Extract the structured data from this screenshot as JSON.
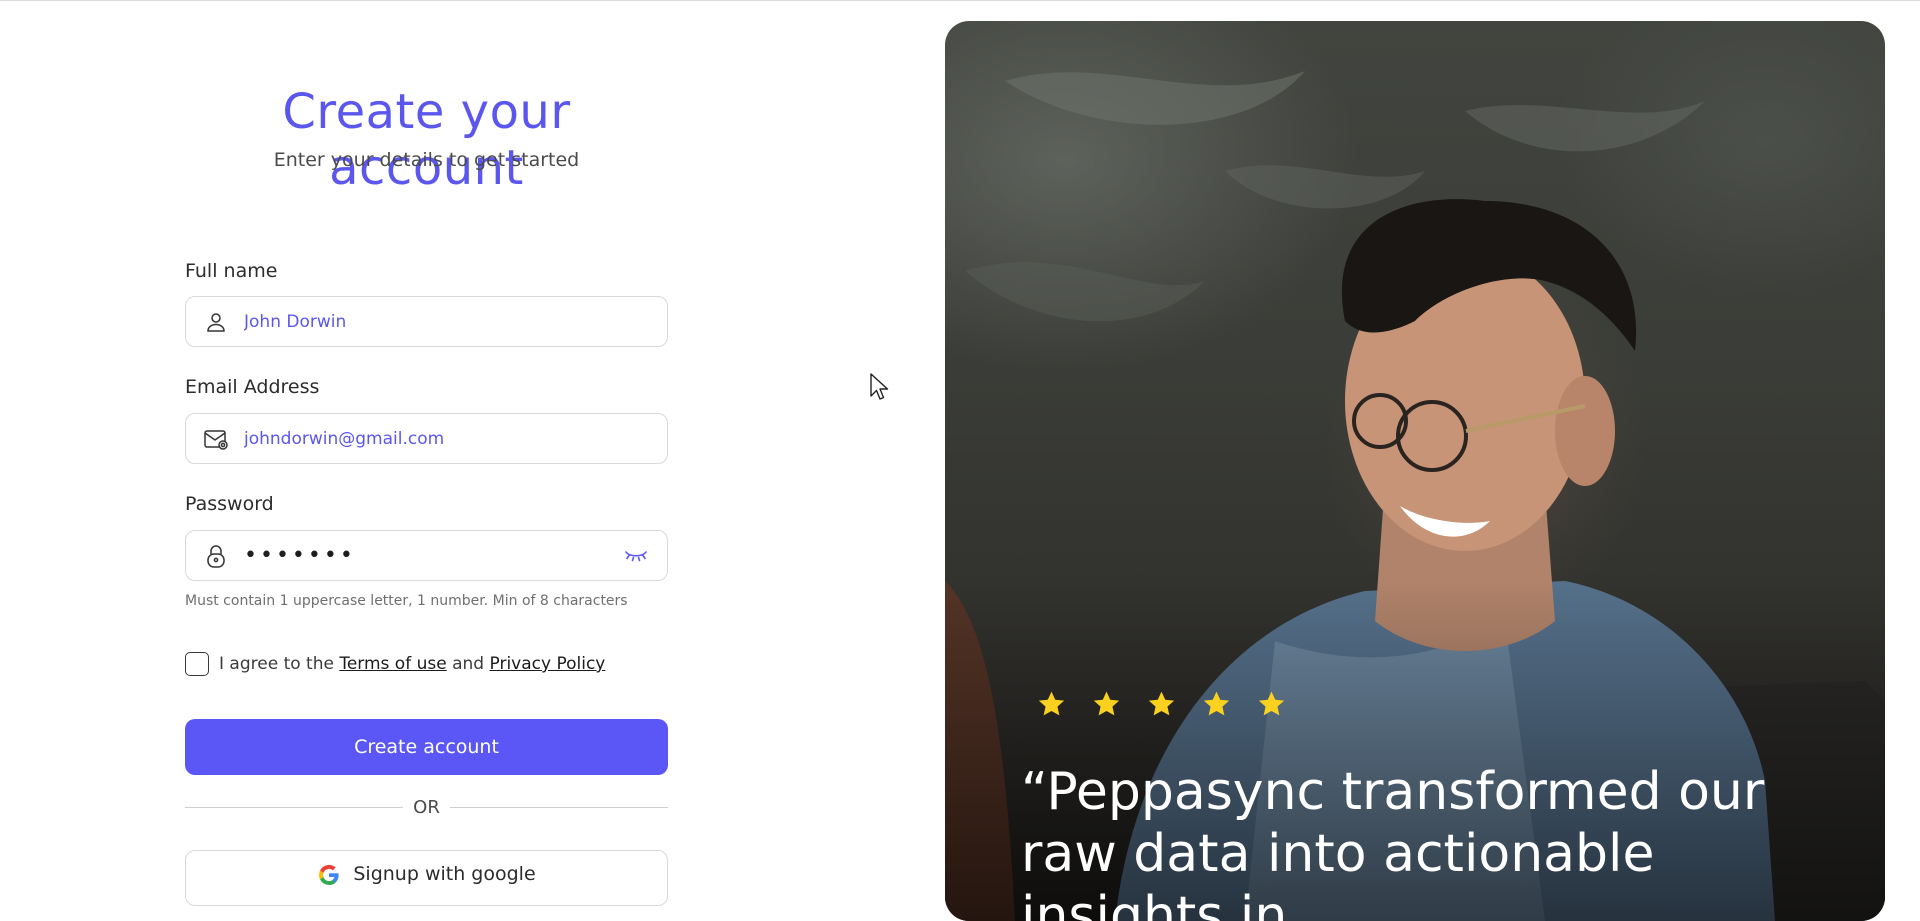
{
  "signup": {
    "title": "Create your account",
    "subtitle": "Enter your details to get started",
    "full_name": {
      "label": "Full name",
      "value": "John Dorwin"
    },
    "email": {
      "label": "Email Address",
      "value": "johndorwin@gmail.com"
    },
    "password": {
      "label": "Password",
      "value": "•••••••",
      "hint": "Must contain 1 uppercase letter, 1 number. Min of 8 characters"
    },
    "agree": {
      "prefix": "I agree to the",
      "terms_link": "Terms of use",
      "conjunction": "and",
      "privacy_link": "Privacy Policy",
      "checked": false
    },
    "submit_label": "Create account",
    "divider_text": "OR",
    "google_label": "Signup with google"
  },
  "testimonial": {
    "rating": 5,
    "quote": "“Peppasync transformed our raw data into actionable insights in"
  },
  "colors": {
    "accent": "#5b57f6",
    "title": "#5b57ee",
    "star": "#f9d11e"
  },
  "icons": {
    "full_name": "user-icon",
    "email": "mail-icon",
    "password": "lock-icon",
    "password_toggle": "eye-closed-icon",
    "google": "google-icon",
    "star": "star-icon"
  }
}
